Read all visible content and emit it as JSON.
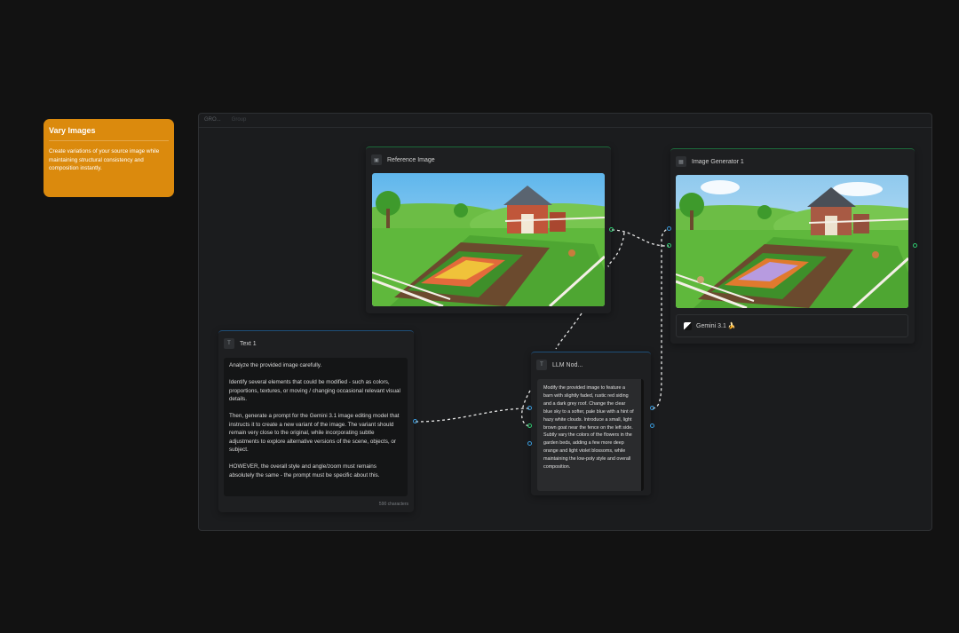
{
  "note": {
    "title": "Vary Images",
    "body": "Create variations of your source image while maintaining structural consistency and composition instantly."
  },
  "group": {
    "title": "GRO...",
    "subtitle": "Group"
  },
  "reference_node": {
    "title": "Reference Image",
    "icon": "image-icon"
  },
  "generator_node": {
    "title": "Image Generator 1",
    "icon": "image-generator-icon",
    "model": "Gemini 3.1 🍌"
  },
  "text_node": {
    "title": "Text 1",
    "icon": "text-icon",
    "paragraphs": [
      "Analyze the provided image carefully.",
      "Identify several elements that could be modified - such as colors, proportions, textures, or moving / changing occasional relevant visual details.",
      "Then, generate a prompt for the Gemini 3.1 image editing model that instructs it to create a new variant of the image. The variant should remain very close to the original, while incorporating subtle adjustments to explore alternative versions of the scene, objects, or subject.",
      "HOWEVER, the overall style and angle/zoom must remains absolutely the same - the prompt must be specific about this."
    ],
    "char_count": "590 characters"
  },
  "llm_node": {
    "title": "LLM Nod...",
    "icon": "llm-icon",
    "output": "Modify the provided image to feature a barn with slightly faded, rustic red siding and a dark grey roof. Change the clear blue sky to a softer, pale blue with a hint of hazy white clouds. Introduce a small, light brown goat near the fence on the left side. Subtly vary the colors of the flowers in the garden beds, adding a few more deep orange and light violet blossoms, while maintaining the low-poly style and overall composition."
  },
  "colors": {
    "background": "#121212",
    "note": "#db8a0d",
    "image_port": "#2ecc71",
    "text_port": "#3a9bdc",
    "wire": "#e6e6e6"
  }
}
